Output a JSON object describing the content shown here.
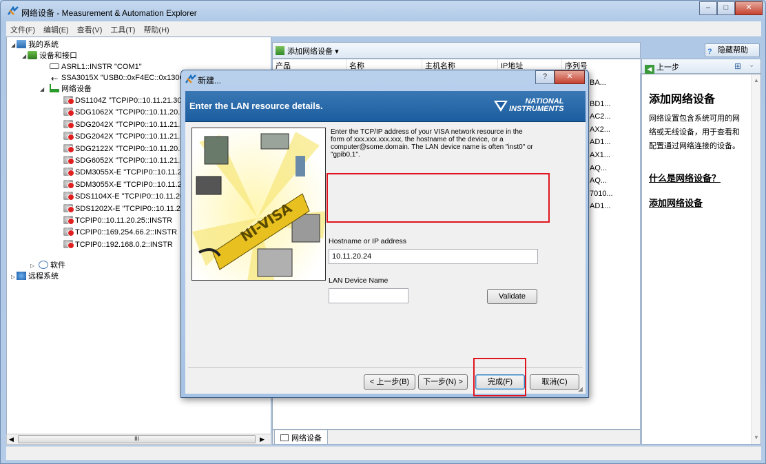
{
  "window": {
    "title": "网络设备 - Measurement & Automation Explorer",
    "controls": {
      "minimize": "‒",
      "maximize": "□",
      "close": "✕"
    }
  },
  "menu": [
    "文件(F)",
    "编辑(E)",
    "查看(V)",
    "工具(T)",
    "帮助(H)"
  ],
  "tree": {
    "root": "我的系统",
    "devices_interfaces": "设备和接口",
    "asrl": "ASRL1::INSTR \"COM1\"",
    "usb": "SSA3015X \"USB0::0xF4EC::0x1300:",
    "network_devices": "网络设备",
    "network_items": [
      "DS1104Z \"TCPIP0::10.11.21.30",
      "SDG1062X \"TCPIP0::10.11.20.2",
      "SDG2042X \"TCPIP0::10.11.21.2",
      "SDG2042X \"TCPIP0::10.11.21.2",
      "SDG2122X \"TCPIP0::10.11.20.2",
      "SDG6052X \"TCPIP0::10.11.21.2",
      "SDM3055X-E \"TCPIP0::10.11.2",
      "SDM3055X-E \"TCPIP0::10.11.2",
      "SDS1104X-E \"TCPIP0::10.11.20",
      "SDS1202X-E \"TCPIP0::10.11.20",
      "TCPIP0::10.11.20.25::INSTR",
      "TCPIP0::169.254.66.2::INSTR",
      "TCPIP0::192.168.0.2::INSTR"
    ],
    "software": "软件",
    "remote": "远程系统"
  },
  "scroll_mark": "III",
  "toolbar": {
    "add_device": "添加网络设备",
    "hide_help": "隐藏帮助"
  },
  "columns": [
    "产品",
    "名称",
    "主机名称",
    "IP地址",
    "序列号"
  ],
  "serial_partials": [
    "BA...",
    "BD1...",
    "AC2...",
    "AX2...",
    "AD1...",
    "AX1...",
    "AQ...",
    "AQ...",
    "7010...",
    "AD1..."
  ],
  "mid_tab": "网络设备",
  "help": {
    "back": "上一步",
    "title": "添加网络设备",
    "desc": "网络设置包含系统可用的网络或无线设备，用于查看和配置通过网络连接的设备。",
    "link1": "什么是网络设备？",
    "link2": "添加网络设备"
  },
  "dialog": {
    "title": "新建...",
    "help_btn": "?",
    "close_btn": "✕",
    "banner": "Enter the LAN resource details.",
    "logo_line1": "NATIONAL",
    "logo_line2": "INSTRUMENTS",
    "illus_text": "NI-VISA",
    "instructions": "Enter the TCP/IP address of your VISA network resource in the form of xxx.xxx.xxx.xxx, the hostname of the device, or a computer@some.domain. The LAN device name is often \"inst0\" or \"gpib0,1\".",
    "host_label": "Hostname or IP address",
    "host_value": "10.11.20.24",
    "lan_label": "LAN Device Name",
    "lan_value": "",
    "validate": "Validate",
    "back": "< 上一步(B)",
    "next": "下一步(N) >",
    "finish": "完成(F)",
    "cancel": "取消(C)"
  },
  "colors": {
    "highlight": "#e0141e",
    "banner": "#1b5da0",
    "link": "#000000"
  }
}
